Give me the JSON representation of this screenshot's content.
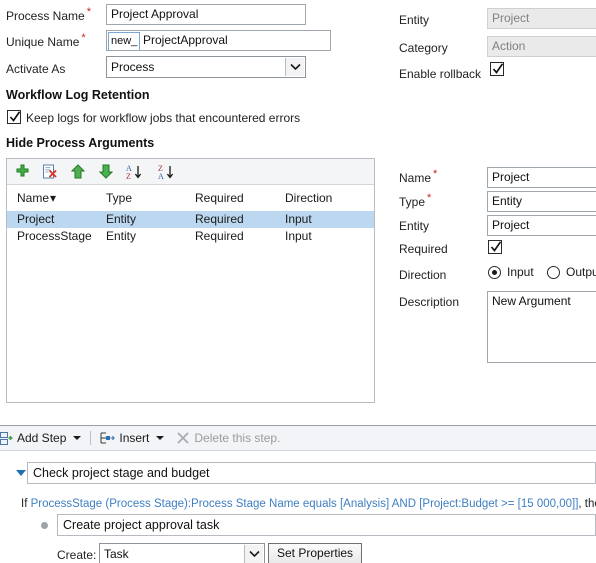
{
  "form": {
    "process_name": {
      "label": "Process Name",
      "required": true,
      "value": "Project Approval"
    },
    "unique_name": {
      "label": "Unique Name",
      "required": true,
      "prefix": "new_",
      "value": "ProjectApproval"
    },
    "activate_as": {
      "label": "Activate As",
      "value": "Process"
    },
    "entity": {
      "label": "Entity",
      "value": "Project"
    },
    "category": {
      "label": "Category",
      "value": "Action"
    },
    "enable_rollback": {
      "label": "Enable rollback",
      "checked": true
    }
  },
  "log_retention": {
    "heading": "Workflow Log Retention",
    "keep_logs": {
      "label": "Keep logs for workflow jobs that encountered errors",
      "checked": true
    }
  },
  "arguments": {
    "heading": "Hide Process Arguments",
    "toolbar": [
      {
        "name": "add-argument",
        "icon": "plus-icon",
        "title": "Add"
      },
      {
        "name": "delete-argument",
        "icon": "delete-document-icon",
        "title": "Delete"
      },
      {
        "name": "move-up",
        "icon": "arrow-up-icon",
        "title": "Move Up"
      },
      {
        "name": "move-down",
        "icon": "arrow-down-icon",
        "title": "Move Down"
      },
      {
        "name": "sort-ascending",
        "icon": "sort-az-icon",
        "title": "Sort A-Z"
      },
      {
        "name": "sort-descending",
        "icon": "sort-za-icon",
        "title": "Sort Z-A"
      }
    ],
    "columns": [
      "Name",
      "Type",
      "Required",
      "Direction"
    ],
    "sorted_column": "Name",
    "sort_caret": "▾",
    "rows": [
      {
        "name": "Project",
        "type": "Entity",
        "required": "Required",
        "direction": "Input",
        "selected": true
      },
      {
        "name": "ProcessStage",
        "type": "Entity",
        "required": "Required",
        "direction": "Input",
        "selected": false
      }
    ]
  },
  "argument_detail": {
    "name": {
      "label": "Name",
      "required": true,
      "value": "Project"
    },
    "type": {
      "label": "Type",
      "required": true,
      "value": "Entity"
    },
    "entity": {
      "label": "Entity",
      "value": "Project"
    },
    "required": {
      "label": "Required",
      "checked": true
    },
    "direction": {
      "label": "Direction",
      "options": [
        "Input",
        "Output"
      ],
      "selected": "Input"
    },
    "description": {
      "label": "Description",
      "value": "New Argument"
    }
  },
  "step_toolbar": {
    "add_step": {
      "label": "Add Step",
      "icon": "add-step-icon",
      "has_caret": true,
      "enabled": true
    },
    "insert": {
      "label": "Insert",
      "icon": "insert-icon",
      "has_caret": true,
      "enabled": true
    },
    "delete_step": {
      "label": "Delete this step.",
      "icon": "x-icon",
      "enabled": false
    }
  },
  "designer": {
    "step": {
      "label": "Check project stage and budget"
    },
    "condition": {
      "prefix": "If ",
      "expression": "ProcessStage (Process Stage):Process Stage Name equals [Analysis] AND [Project:Budget >= [15 000,00]]",
      "suffix": ", then:"
    },
    "child_step": {
      "label": "Create project approval task"
    },
    "create": {
      "label": "Create:",
      "value": "Task",
      "options": [
        "Task"
      ]
    },
    "set_properties_button": "Set Properties"
  },
  "colors": {
    "selection": "#bcd7f0",
    "link": "#3e7fc1",
    "required_asterisk": "#cc2222",
    "toolbar_bg": "#f2f4f7"
  }
}
